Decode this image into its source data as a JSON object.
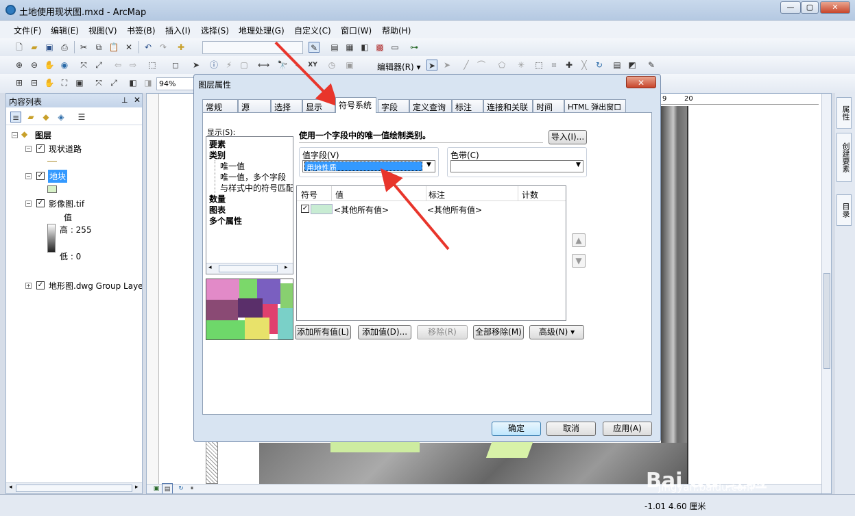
{
  "window": {
    "title": "土地使用现状图.mxd - ArcMap"
  },
  "menu": [
    "文件(F)",
    "编辑(E)",
    "视图(V)",
    "书签(B)",
    "插入(I)",
    "选择(S)",
    "地理处理(G)",
    "自定义(C)",
    "窗口(W)",
    "帮助(H)"
  ],
  "toolbar": {
    "editor_label": "编辑器(R) ▾",
    "zoom_value": "94%"
  },
  "toc": {
    "title": "内容列表",
    "root": "图层",
    "layers": [
      {
        "name": "现状道路",
        "checked": true
      },
      {
        "name": "地块",
        "checked": true,
        "selected": true
      },
      {
        "name": "影像图.tif",
        "checked": true,
        "legend_title": "值",
        "high": "高 : 255",
        "low": "低 : 0"
      },
      {
        "name": "地形图.dwg Group Layer",
        "checked": true
      }
    ]
  },
  "side_tabs": [
    "属性",
    "创建要素",
    "目录"
  ],
  "ruler": {
    "a": "9",
    "b": "20"
  },
  "status": {
    "coords": "-1.01  4.60 厘米"
  },
  "watermark": {
    "brand": "Bai du 经验",
    "url": "jingyan.baidu.com"
  },
  "dialog": {
    "title": "图层属性",
    "tabs": [
      "常规",
      "源",
      "选择",
      "显示",
      "符号系统",
      "字段",
      "定义查询",
      "标注",
      "连接和关联",
      "时间",
      "HTML 弹出窗口"
    ],
    "active_tab": "符号系统",
    "show_label": "显示(S):",
    "show_tree": [
      "要素",
      "类别",
      "唯一值",
      "唯一值，多个字段",
      "与样式中的符号匹配",
      "数量",
      "图表",
      "多个属性"
    ],
    "heading": "使用一个字段中的唯一值绘制类别。",
    "import_button": "导入(I)...",
    "value_field_label": "值字段(V)",
    "value_field_value": "用地性质",
    "color_ramp_label": "色带(C)",
    "table_headers": [
      "符号",
      "值",
      "标注",
      "计数"
    ],
    "table_rows": [
      {
        "value": "<其他所有值>",
        "label": "<其他所有值>",
        "count": ""
      }
    ],
    "buttons": {
      "add_all": "添加所有值(L)",
      "add": "添加值(D)...",
      "remove": "移除(R)",
      "remove_all": "全部移除(M)",
      "advanced": "高级(N)"
    },
    "footer": {
      "ok": "确定",
      "cancel": "取消",
      "apply": "应用(A)"
    }
  },
  "colors": {
    "accent": "#3399ff",
    "annotation_arrow": "#e8352b",
    "symbol_fill": "#c8ecd3"
  }
}
